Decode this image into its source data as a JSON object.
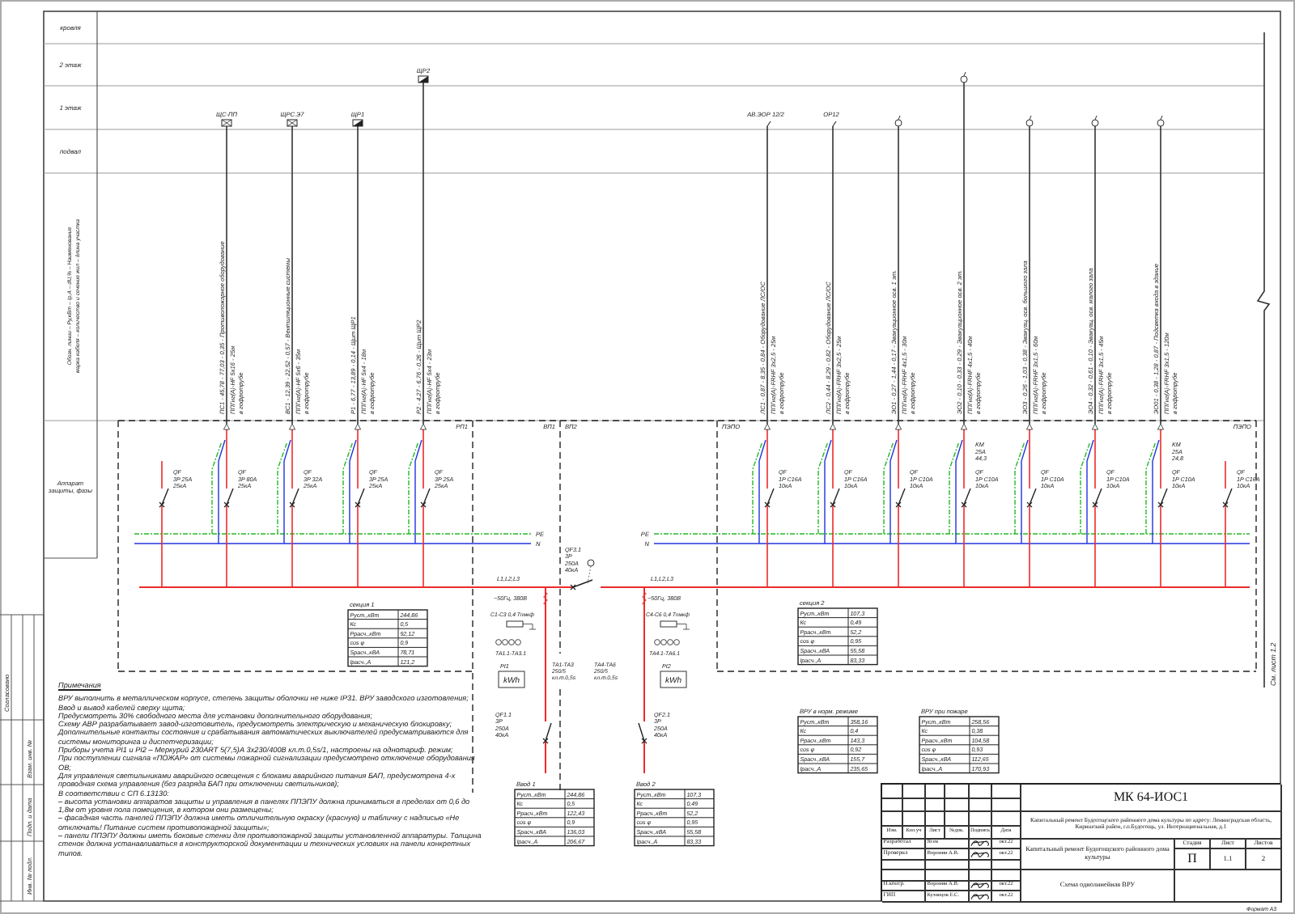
{
  "frame": {
    "rows": [
      "кровля",
      "2 этаж",
      "1 этаж",
      "подвал"
    ],
    "cable_header": [
      "Обозн. линии – Ру,кВт – Iр,А – dU,% – Наименование",
      "марка кабеля – количество и сечение жил – длина участка"
    ],
    "protection_header": "Аппарат защиты, фазы",
    "continuation": "См. лист 1.2",
    "stamp": [
      "Согласовано",
      "Взам. инв. №",
      "Подп. и дата",
      "Инв. № подл."
    ],
    "format": "Формат А3"
  },
  "panels": [
    "РП1",
    "ВП1",
    "ВП2",
    "ПЭПО",
    "ПЭПО"
  ],
  "sections": [
    {
      "buses": [
        {
          "kind": "pe",
          "label": "PE"
        },
        {
          "kind": "n",
          "label": "N"
        },
        {
          "kind": "phase"
        }
      ],
      "spare": {
        "breaker": [
          "QF",
          "3P 25A",
          "25кА"
        ]
      },
      "feeders": [
        {
          "kind": "floor1",
          "target": {
            "kind": "box",
            "label": "ЩС-ПП"
          },
          "line": "ПС1 - 45,78 - 77,03 - 0,35 - Противопожарное оборудование",
          "cable": "ППГнг(А)-HF 5х16 - 25м",
          "laying": "в гофротрубе",
          "breaker": [
            "QF",
            "3P 80A",
            "25кА"
          ]
        },
        {
          "kind": "floor1",
          "target": {
            "kind": "box",
            "label": "ЩРС.Э7"
          },
          "line": "ВС1 - 12,39 - 22,52 - 0,57 - Вентиляционные системы",
          "cable": "ППГнг(А)-HF 5х6 - 35м",
          "laying": "в гофротрубе",
          "breaker": [
            "QF",
            "3P 32A",
            "25кА"
          ]
        },
        {
          "kind": "floor1",
          "target": {
            "kind": "panel",
            "label": "ЩР1"
          },
          "line": "Р1 - 6,77 - 13,89 - 0,14 - Щит ЩР1",
          "cable": "ППГнг(А)-HF 5х4 - 18м",
          "laying": "в гофротрубе",
          "breaker": [
            "QF",
            "3P 25A",
            "25кА"
          ]
        },
        {
          "kind": "floor2",
          "target": {
            "kind": "panel",
            "label": "ЩР2"
          },
          "line": "Р2 - 4,27 - 6,76 - 0,26 - Щит ЩР2",
          "cable": "ППГнг(А)-HF 5х4 - 23м",
          "laying": "в гофротрубе",
          "breaker": [
            "QF",
            "3P 25A",
            "25кА"
          ]
        }
      ],
      "table": {
        "title": "секция 1",
        "rows": [
          [
            "Руст.,кВт",
            "244,86"
          ],
          [
            "Кс",
            "0,5"
          ],
          [
            "Ррасч.,кВт",
            "92,12"
          ],
          [
            "cos φ",
            "0,9"
          ],
          [
            "Sрасч.,кВА",
            "78,71"
          ],
          [
            "Iрасч.,А",
            "121,2"
          ]
        ]
      }
    },
    {
      "buses": [
        {
          "kind": "pe",
          "label": "PE"
        },
        {
          "kind": "n",
          "label": "N"
        },
        {
          "kind": "phase"
        }
      ],
      "spare": {
        "breaker": [
          "QF",
          "1P C16A",
          "10кА"
        ]
      },
      "feeders": [
        {
          "kind": "floor1",
          "target": {
            "kind": "tag",
            "label": "АВ.ЭОР 12/2"
          },
          "line": "ЛС1 - 0,87 - 8,35 - 0,84 - Оборудование ЛС/ОС",
          "cable": "ППГнг(А)-FRHF 3х2,5 - 25м",
          "laying": "в гофротрубе",
          "breaker": [
            "QF",
            "1P C16A",
            "10кА"
          ]
        },
        {
          "kind": "floor1",
          "target": {
            "kind": "tag",
            "label": "ОР12"
          },
          "line": "ЛС2 - 0,44 - 8,29 - 0,82 - Оборудование ЛС/ОС",
          "cable": "ППГнг(А)-FRHF 3х2,5 - 25м",
          "laying": "в гофротрубе",
          "breaker": [
            "QF",
            "1P C16A",
            "10кА"
          ]
        },
        {
          "kind": "floor1",
          "target": {
            "kind": "lamp"
          },
          "line": "ЭО1 - 0,27 - 1,44 - 0,17 - Эвакуационное осв. 1 эт.",
          "cable": "ППГнг(А)-FRHF 4х1,5 - 30м",
          "laying": "в гофротрубе",
          "breaker": [
            "QF",
            "1P C10A",
            "10кА"
          ]
        },
        {
          "kind": "floor2",
          "target": {
            "kind": "lamp"
          },
          "line": "ЭО2 - 0,10 - 0,33 - 0,29 - Эвакуационное осв. 2 эт.",
          "cable": "ППГнг(А)-FRHF 4х1,5 - 40м",
          "laying": "в гофротрубе",
          "breaker": [
            "QF",
            "1P C10A",
            "10кА"
          ],
          "contactor": [
            "KM",
            "25A",
            "44,3"
          ]
        },
        {
          "kind": "floor1",
          "target": {
            "kind": "lamp"
          },
          "line": "ЭО3 - 0,26 - 1,03 - 0,38 - Эвакуац. осв. большого зала",
          "cable": "ППГнг(А)-FRHF 3х1,5 - 60м",
          "laying": "в гофротрубе",
          "breaker": [
            "QF",
            "1P C10A",
            "10кА"
          ]
        },
        {
          "kind": "floor1",
          "target": {
            "kind": "lamp"
          },
          "line": "ЭО4 - 0,32 - 0,61 - 0,10 - Эвакуац. осв. малого зала",
          "cable": "ППГнг(А)-FRHF 3х1,5 - 45м",
          "laying": "в гофротрубе",
          "breaker": [
            "QF",
            "1P C10A",
            "10кА"
          ]
        },
        {
          "kind": "floor1",
          "target": {
            "kind": "lamp"
          },
          "line": "ЭО01 - 0,38 - 1,28 - 0,87 - Подсветка входа в здание",
          "cable": "ППГнг(А)-FRHF 3х1,5 - 120м",
          "laying": "в гофротрубе",
          "breaker": [
            "QF",
            "1P C10A",
            "10кА"
          ],
          "contactor": [
            "KM",
            "25A",
            "24,8"
          ]
        }
      ],
      "table": {
        "title": "секция 2",
        "rows": [
          [
            "Руст.,кВт",
            "107,3"
          ],
          [
            "Кс",
            "0,49"
          ],
          [
            "Ррасч.,кВт",
            "52,2"
          ],
          [
            "cos φ",
            "0,95"
          ],
          [
            "Sрасч.,кВА",
            "55,58"
          ],
          [
            "Iрасч.,А",
            "83,33"
          ]
        ]
      }
    }
  ],
  "tie": {
    "breaker": [
      "QF3.1",
      "3P",
      "250A",
      "40кА"
    ]
  },
  "inputs": [
    {
      "phases": "L1,L2,L3",
      "supply": "~50Гц, 380В",
      "capacitors": "C1-C3 0,4 Тпмкф",
      "ct_group": "ТА1.1-ТА3.1",
      "meter": "PI1",
      "meter_unit": "kWh",
      "ct": [
        "ТА1-ТА3",
        "250/5",
        "кл.т.0,5s"
      ],
      "breaker": [
        "QF1.1",
        "3P",
        "250A",
        "40кА"
      ],
      "table": {
        "title": "Ввод 1",
        "rows": [
          [
            "Руст.,кВт",
            "244,86"
          ],
          [
            "Кс",
            "0,5"
          ],
          [
            "Ррасч.,кВт",
            "122,43"
          ],
          [
            "cos φ",
            "0,9"
          ],
          [
            "Sрасч.,кВА",
            "136,03"
          ],
          [
            "Iрасч.,А",
            "206,67"
          ]
        ]
      }
    },
    {
      "phases": "L1,L2,L3",
      "supply": "~50Гц, 380В",
      "capacitors": "C4-C6 0,4 Тпмкф",
      "ct_group": "ТА4.1-ТА6.1",
      "meter": "PI2",
      "meter_unit": "kWh",
      "ct": [
        "ТА4-ТА6",
        "250/5",
        "кл.т.0,5s"
      ],
      "breaker": [
        "QF2.1",
        "3P",
        "250A",
        "40кА"
      ],
      "table": {
        "title": "Ввод 2",
        "rows": [
          [
            "Руст.,кВт",
            "107,3"
          ],
          [
            "Кс",
            "0,49"
          ],
          [
            "Ррасч.,кВт",
            "52,2"
          ],
          [
            "cos φ",
            "0,95"
          ],
          [
            "Sрасч.,кВА",
            "55,58"
          ],
          [
            "Iрасч.,А",
            "83,33"
          ]
        ]
      }
    }
  ],
  "system_tables": [
    {
      "title": "ВРУ в норм. режиме",
      "rows": [
        [
          "Руст.,кВт",
          "358,16"
        ],
        [
          "Кс",
          "0,4"
        ],
        [
          "Ррасч.,кВт",
          "143,3"
        ],
        [
          "cos φ",
          "0,92"
        ],
        [
          "Sрасч.,кВА",
          "155,7"
        ],
        [
          "Iрасч.,А",
          "235,65"
        ]
      ]
    },
    {
      "title": "ВРУ при пожаре",
      "rows": [
        [
          "Руст.,кВт",
          "258,56"
        ],
        [
          "Кс",
          "0,38"
        ],
        [
          "Ррасч.,кВт",
          "104,58"
        ],
        [
          "cos φ",
          "0,93"
        ],
        [
          "Sрасч.,кВА",
          "112,65"
        ],
        [
          "Iрасч.,А",
          "170,93"
        ]
      ]
    }
  ],
  "notes": {
    "title": "Примечания",
    "items": [
      "ВРУ выполнить в металлическом корпусе, степень защиты оболочки не ниже IP31. ВРУ заводского изготовления;",
      "Ввод и вывод кабелей сверху щита;",
      "Предусмотреть 30% свободного места для установки дополнительного оборудования;",
      "Схему АВР разрабатывает завод-изготовитель, предусмотреть электрическую и механическую блокировку;",
      "Дополнительные контакты состояния и срабатывания автоматических выключателей предусматриваются для системы мониторинга и диспетчеризации;",
      "Приборы учета PI1 и PI2 – Меркурий 230ART 5(7,5)А 3х230/400В кл.т.0,5s/1, настроены на однотариф. режим;",
      "При поступлении сигнала «ПОЖАР» от системы пожарной сигнализации предусмотрено отключение оборудования ОВ;",
      "Для управления светильниками аварийного освещения с блоками аварийного питания БАП, предусмотрена 4-х проводная схема управления (без разряда БАП при отключении светильников);",
      "В соответствии с СП 6.13130:",
      "– высота установки аппаратов защиты и управления в панелях ППЭПУ должна приниматься в пределах от 0,6 до 1,8м от уровня пола помещения, в котором они размещены;",
      "– фасадная часть панелей ППЭПУ должна иметь отличительную окраску (красную) и табличку с надписью «Не отключать! Питание систем противопожарной защиты»;",
      "– панели ППЭПУ должны иметь боковые стенки для противопожарной защиты установленной аппаратуры. Толщина стенок должна устанавливаться в конструкторской документации и технических условиях на панели конкретных типов."
    ]
  },
  "title_block": {
    "code": "МК 64-ИОС1",
    "object": "Капитальный ремонт Будогощского районного дома культуры по адресу: Ленинградская область, Киришский район, г.п.Будогощь, ул. Интернациональная, д.1",
    "project": "Капитальный ремонт Будогощского районного дома культуры",
    "sheet_title": "Схема однолинейная ВРУ",
    "headers": [
      "Изм.",
      "Кол.уч",
      "Лист",
      "№док.",
      "Подпись",
      "Дата"
    ],
    "stage_headers": [
      "Стадия",
      "Лист",
      "Листов"
    ],
    "stage_values": [
      "П",
      "1.1",
      "2"
    ],
    "signers": [
      {
        "role": "Разработал",
        "name": "Ясев",
        "date": "окт.22",
        "signed": true
      },
      {
        "role": "Проверил",
        "name": "Воронин А.В.",
        "date": "окт.22",
        "signed": true
      },
      {
        "role": "Н.контр.",
        "name": "Воронин А.В.",
        "date": "окт.22",
        "signed": true
      },
      {
        "role": "ГИП",
        "name": "Кузнецов Е.С.",
        "date": "окт.22",
        "signed": true
      }
    ]
  }
}
